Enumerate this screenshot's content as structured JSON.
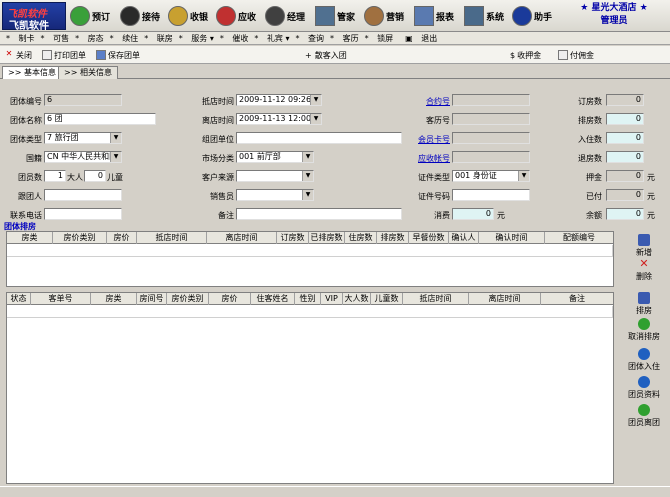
{
  "app": {
    "logo_line1": "飞凯软件",
    "logo_line2": "飞凯软件",
    "hotel_name": "星光大酒店",
    "user_role": "管理员"
  },
  "toolbar": [
    {
      "label": "预订",
      "icon": "calendar-icon",
      "color": "#3aa03a"
    },
    {
      "label": "接待",
      "icon": "people-icon",
      "color": "#2a2a2a"
    },
    {
      "label": "收银",
      "icon": "money-bag-icon",
      "color": "#c8a030"
    },
    {
      "label": "应收",
      "icon": "dollar-icon",
      "color": "#c03030"
    },
    {
      "label": "经理",
      "icon": "manager-icon",
      "color": "#404040"
    },
    {
      "label": "管家",
      "icon": "house-icon",
      "color": "#507090"
    },
    {
      "label": "营销",
      "icon": "handshake-icon",
      "color": "#a07040"
    },
    {
      "label": "报表",
      "icon": "report-icon",
      "color": "#5a7ab0"
    },
    {
      "label": "系统",
      "icon": "computer-icon",
      "color": "#4a6a8a"
    },
    {
      "label": "助手",
      "icon": "info-icon",
      "color": "#1a3a9a"
    }
  ],
  "menu": [
    "制卡",
    "可售",
    "房态",
    "续住",
    "联房",
    "服务",
    "催收",
    "礼宾",
    "查询",
    "客历",
    "锁屏",
    "退出"
  ],
  "actions": {
    "close": "关闭",
    "print": "打印团单",
    "save": "保存团单",
    "add_group": "散客入团",
    "deposit": "收押金",
    "commission": "付佣金"
  },
  "tabs": [
    "基本信息",
    "相关信息"
  ],
  "form": {
    "group_no_label": "团体编号",
    "group_no": "6",
    "group_name_label": "团体名称",
    "group_name": "6 团",
    "group_type_label": "团体类型",
    "group_type": "7 旅行团",
    "nationality_label": "国籍",
    "nationality": "CN 中华人民共和国",
    "members_label": "团员数",
    "adults": "1",
    "adults_unit": "大人",
    "children": "0",
    "children_unit": "儿童",
    "leader_label": "跟团人",
    "leader": "",
    "phone_label": "联系电话",
    "phone": "",
    "arrival_label": "抵店时间",
    "arrival": "2009-11-12 09:26",
    "departure_label": "离店时间",
    "departure": "2009-11-13 12:00",
    "org_label": "组团单位",
    "org": "",
    "market_label": "市场分类",
    "market": "001 前厅部",
    "source_label": "客户来源",
    "source": "",
    "sales_label": "销售员",
    "sales": "",
    "remark_label": "备注",
    "remark": "",
    "contract_label": "合约号",
    "contract": "",
    "history_label": "客历号",
    "history": "",
    "member_card_label": "会员卡号",
    "member_card": "",
    "ar_account_label": "应收帐号",
    "ar_account": "",
    "id_type_label": "证件类型",
    "id_type": "001 身份证",
    "id_no_label": "证件号码",
    "id_no": "",
    "consumption_label": "消费",
    "consumption": "0",
    "consumption_unit": "元",
    "booked_label": "订房数",
    "booked": "0",
    "arranged_label": "排房数",
    "arranged": "0",
    "checkedin_label": "入住数",
    "checkedin": "0",
    "checkedout_label": "退房数",
    "checkedout": "0",
    "deposit_label": "押金",
    "deposit": "0",
    "deposit_unit": "元",
    "paid_label": "已付",
    "paid": "0",
    "paid_unit": "元",
    "balance_label": "余额",
    "balance": "0",
    "balance_unit": "元"
  },
  "group_section_title": "团体排房",
  "grid1_headers": [
    "房类",
    "房价类别",
    "房价",
    "抵店时间",
    "离店时间",
    "订房数",
    "已排房数",
    "住房数",
    "排房数",
    "早餐份数",
    "确认人",
    "确认时间",
    "配额编号"
  ],
  "grid2_headers": [
    "状态",
    "客单号",
    "房类",
    "房间号",
    "房价类别",
    "房价",
    "住客姓名",
    "性别",
    "VIP",
    "大人数",
    "儿童数",
    "抵店时间",
    "离店时间",
    "备注"
  ],
  "side_buttons": [
    {
      "label": "新增",
      "icon": "new-icon",
      "color": "#3a5ab0"
    },
    {
      "label": "删除",
      "icon": "delete-icon",
      "color": "#d02020"
    },
    {
      "label": "排房",
      "icon": "arrange-icon",
      "color": "#3a5ab0"
    },
    {
      "label": "取消排房",
      "icon": "cancel-arrange-icon",
      "color": "#30a030"
    },
    {
      "label": "团体入住",
      "icon": "group-checkin-icon",
      "color": "#2060c0"
    },
    {
      "label": "团员资料",
      "icon": "member-info-icon",
      "color": "#2060c0"
    },
    {
      "label": "团员离团",
      "icon": "member-leave-icon",
      "color": "#30a030"
    }
  ]
}
